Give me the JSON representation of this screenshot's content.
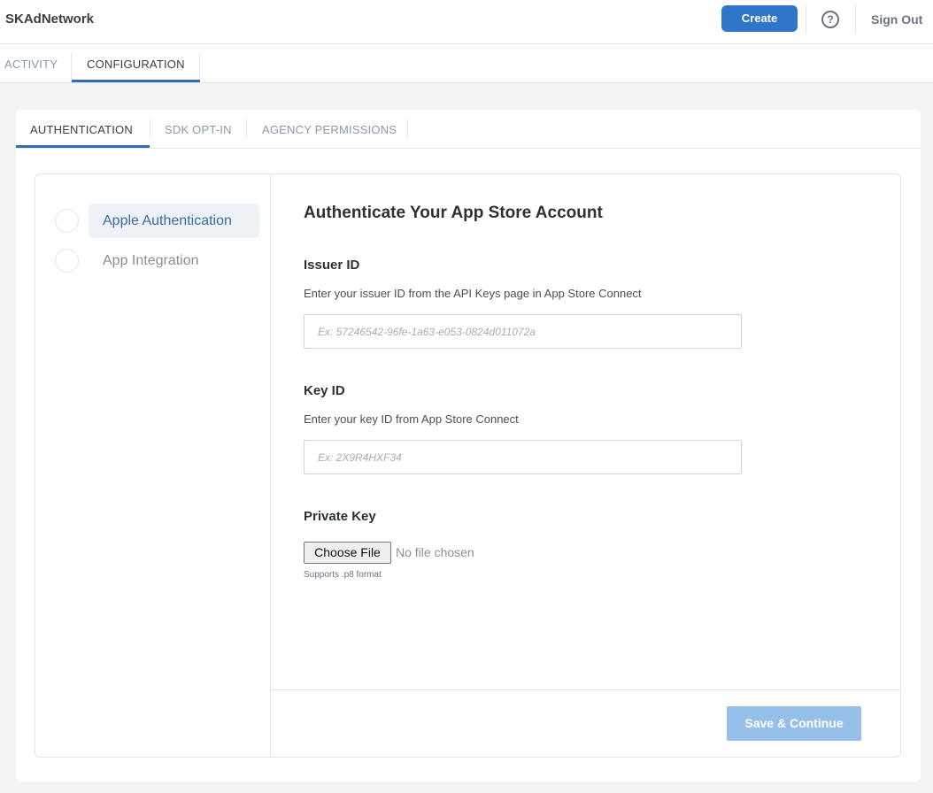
{
  "app": {
    "title": "SKAdNetwork"
  },
  "header": {
    "create_label": "Create",
    "help_icon": "question-circle-icon",
    "help_glyph": "?",
    "signout_label": "Sign Out"
  },
  "nav": {
    "tabs": [
      {
        "label": "ACTIVITY",
        "active": false
      },
      {
        "label": "CONFIGURATION",
        "active": true
      }
    ]
  },
  "subtabs": [
    {
      "label": "AUTHENTICATION",
      "active": true
    },
    {
      "label": "SDK OPT-IN",
      "active": false
    },
    {
      "label": "AGENCY PERMISSIONS",
      "active": false
    }
  ],
  "steps": [
    {
      "label": "Apple Authentication",
      "active": true
    },
    {
      "label": "App Integration",
      "active": false
    }
  ],
  "form": {
    "title": "Authenticate Your App Store Account",
    "issuer": {
      "label": "Issuer ID",
      "help": "Enter your issuer ID from the API Keys page in App Store Connect",
      "value": "",
      "placeholder": "Ex: 57246542-96fe-1a63-e053-0824d011072a"
    },
    "key": {
      "label": "Key ID",
      "help": "Enter your key ID from App Store Connect",
      "value": "",
      "placeholder": "Ex: 2X9R4HXF34"
    },
    "private_key": {
      "label": "Private Key",
      "choose_label": "Choose File",
      "status": "No file chosen",
      "hint": "Supports .p8 format"
    }
  },
  "footer": {
    "save_label": "Save & Continue",
    "save_enabled": false
  },
  "colors": {
    "primary": "#2f76c8",
    "active_tab": "#2f6db3",
    "save_disabled": "#96c0ea",
    "step_active": "#3b6aa8"
  }
}
